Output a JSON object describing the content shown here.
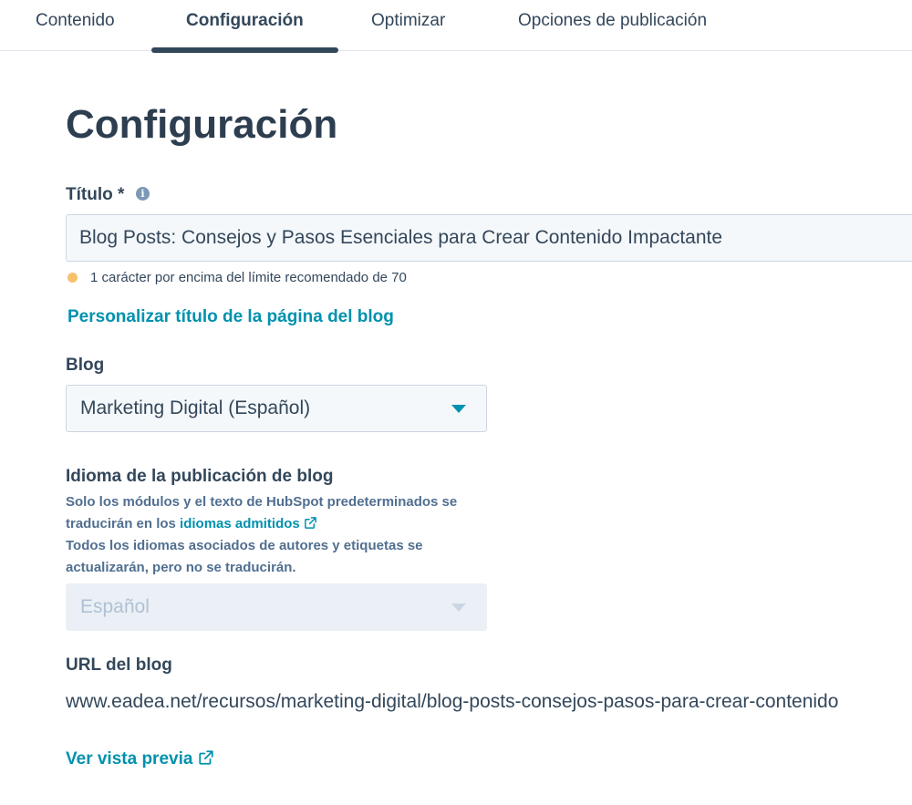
{
  "tabs": [
    {
      "label": "Contenido"
    },
    {
      "label": "Configuración"
    },
    {
      "label": "Optimizar"
    },
    {
      "label": "Opciones de publicación"
    }
  ],
  "active_tab": "Configuración",
  "page_title": "Configuración",
  "title_field": {
    "label": "Título *",
    "value": "Blog Posts: Consejos y Pasos Esenciales para Crear Contenido Impactante",
    "info_icon": "info-icon",
    "warning": "1 carácter por encima del límite recomendado de 70",
    "warning_color": "#f5c26b"
  },
  "customize_title_link": "Personalizar título de la página del blog",
  "blog_field": {
    "label": "Blog",
    "selected": "Marketing Digital (Español)"
  },
  "language_field": {
    "label": "Idioma de la publicación de blog",
    "help_part1": "Solo los módulos y el texto de HubSpot predeterminados se traducirán en los",
    "help_link": "idiomas admitidos",
    "help_part2": "Todos los idiomas asociados de autores y etiquetas se actualizarán, pero no se traducirán.",
    "selected": "Español",
    "disabled": true
  },
  "url_field": {
    "label": "URL del blog",
    "value": "www.eadea.net/recursos/marketing-digital/blog-posts-consejos-pasos-para-crear-contenido"
  },
  "preview_link": "Ver vista previa",
  "colors": {
    "accent": "#0091ae",
    "text": "#33475b",
    "heading": "#2d3e50",
    "tab_indicator": "#33475b"
  }
}
